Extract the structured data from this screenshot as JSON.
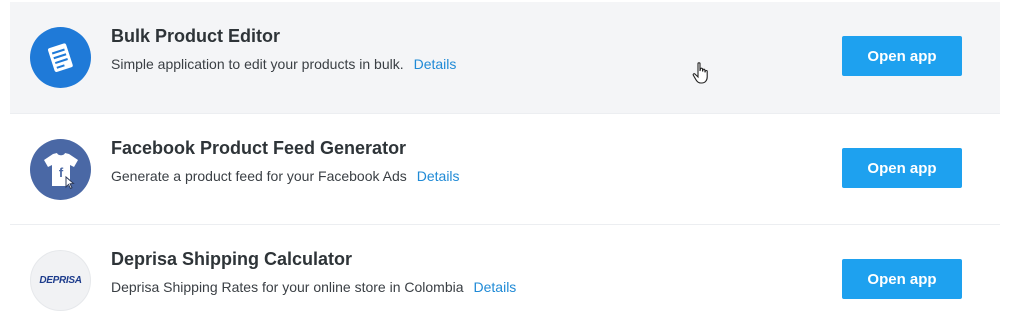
{
  "apps": [
    {
      "title": "Bulk Product Editor",
      "description": "Simple application to edit your products in bulk.",
      "details_label": "Details",
      "button_label": "Open app",
      "icon": "document-list-icon"
    },
    {
      "title": "Facebook Product Feed Generator",
      "description": "Generate a product feed for your Facebook Ads",
      "details_label": "Details",
      "button_label": "Open app",
      "icon": "facebook-tshirt-icon"
    },
    {
      "title": "Deprisa Shipping Calculator",
      "description": "Deprisa Shipping Rates for your online store in Colombia",
      "details_label": "Details",
      "button_label": "Open app",
      "icon": "deprisa-logo-icon",
      "logo_text": "DEPRISA"
    }
  ],
  "colors": {
    "button": "#1ea1ef",
    "link": "#1f8ad6",
    "hover_row": "#f4f5f7"
  }
}
